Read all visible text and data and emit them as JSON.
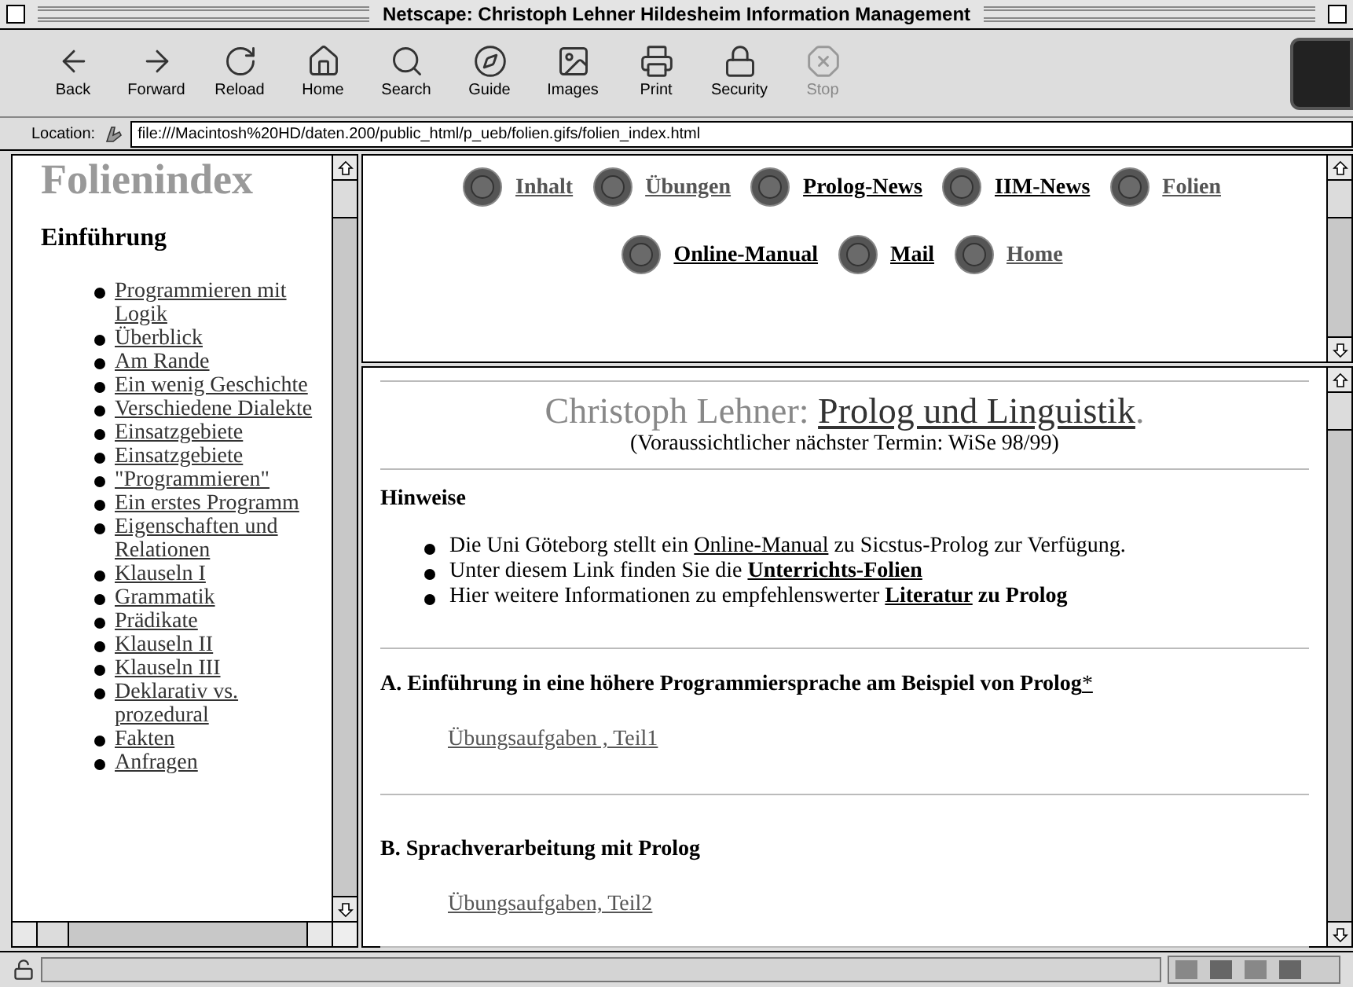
{
  "window": {
    "title": "Netscape: Christoph Lehner Hildesheim Information Management"
  },
  "toolbar": [
    {
      "label": "Back",
      "kind": "back",
      "disabled": false
    },
    {
      "label": "Forward",
      "kind": "forward",
      "disabled": false
    },
    {
      "label": "Reload",
      "kind": "reload",
      "disabled": false
    },
    {
      "label": "Home",
      "kind": "home",
      "disabled": false
    },
    {
      "label": "Search",
      "kind": "search",
      "disabled": false
    },
    {
      "label": "Guide",
      "kind": "guide",
      "disabled": false
    },
    {
      "label": "Images",
      "kind": "images",
      "disabled": false
    },
    {
      "label": "Print",
      "kind": "print",
      "disabled": false
    },
    {
      "label": "Security",
      "kind": "security",
      "disabled": false
    },
    {
      "label": "Stop",
      "kind": "stop",
      "disabled": true
    }
  ],
  "location": {
    "label": "Location:",
    "value": "file:///Macintosh%20HD/daten.200/public_html/p_ueb/folien.gifs/folien_index.html"
  },
  "sidebar": {
    "title": "Folienindex",
    "heading": "Einführung",
    "items": [
      "Programmieren mit Logik",
      "Überblick",
      "Am Rande",
      "Ein wenig Geschichte",
      "Verschiedene Dialekte",
      "Einsatzgebiete",
      "Einsatzgebiete",
      "\"Programmieren\"",
      "Ein erstes Programm",
      "Eigenschaften und Relationen",
      "Klauseln I",
      "Grammatik",
      "Prädikate",
      "Klauseln II",
      "Klauseln III",
      "Deklarativ vs. prozedural",
      "Fakten",
      "Anfragen"
    ]
  },
  "nav": [
    [
      {
        "label": "Inhalt",
        "visited": true
      },
      {
        "label": "Übungen",
        "visited": true
      },
      {
        "label": "Prolog-News",
        "visited": false
      },
      {
        "label": "IIM-News",
        "visited": false
      },
      {
        "label": "Folien",
        "visited": true
      }
    ],
    [
      {
        "label": "Online-Manual",
        "visited": false
      },
      {
        "label": "Mail",
        "visited": false
      },
      {
        "label": "Home",
        "visited": true
      }
    ]
  ],
  "content": {
    "author": "Christoph Lehner:",
    "course": "Prolog und Linguistik",
    "period": ".",
    "subtitle": "(Voraussichtlicher nächster Termin: WiSe 98/99)",
    "notes_heading": "Hinweise",
    "notes": [
      [
        {
          "kind": "text",
          "text": "Die Uni Göteborg stellt ein ",
          "bold": false
        },
        {
          "kind": "link",
          "text": "Online-Manual",
          "bold": false
        },
        {
          "kind": "text",
          "text": " zu Sicstus-Prolog zur Verfügung.",
          "bold": false
        }
      ],
      [
        {
          "kind": "text",
          "text": "Unter diesem Link finden Sie die ",
          "bold": false
        },
        {
          "kind": "link",
          "text": "Unterrichts-Folien",
          "bold": true
        }
      ],
      [
        {
          "kind": "text",
          "text": "Hier weitere Informationen zu empfehlenswerter ",
          "bold": false
        },
        {
          "kind": "link",
          "text": "Literatur",
          "bold": true
        },
        {
          "kind": "text",
          "text": " zu Prolog",
          "bold": true
        }
      ]
    ],
    "sections": [
      {
        "title": "A. Einführung in eine höhere Programmiersprache am Beispiel von Prolog",
        "mark": "*",
        "link": "Übungsaufgaben , Teil1"
      },
      {
        "title": "B. Sprachverarbeitung mit Prolog",
        "link": "Übungsaufgaben, Teil2"
      }
    ]
  }
}
